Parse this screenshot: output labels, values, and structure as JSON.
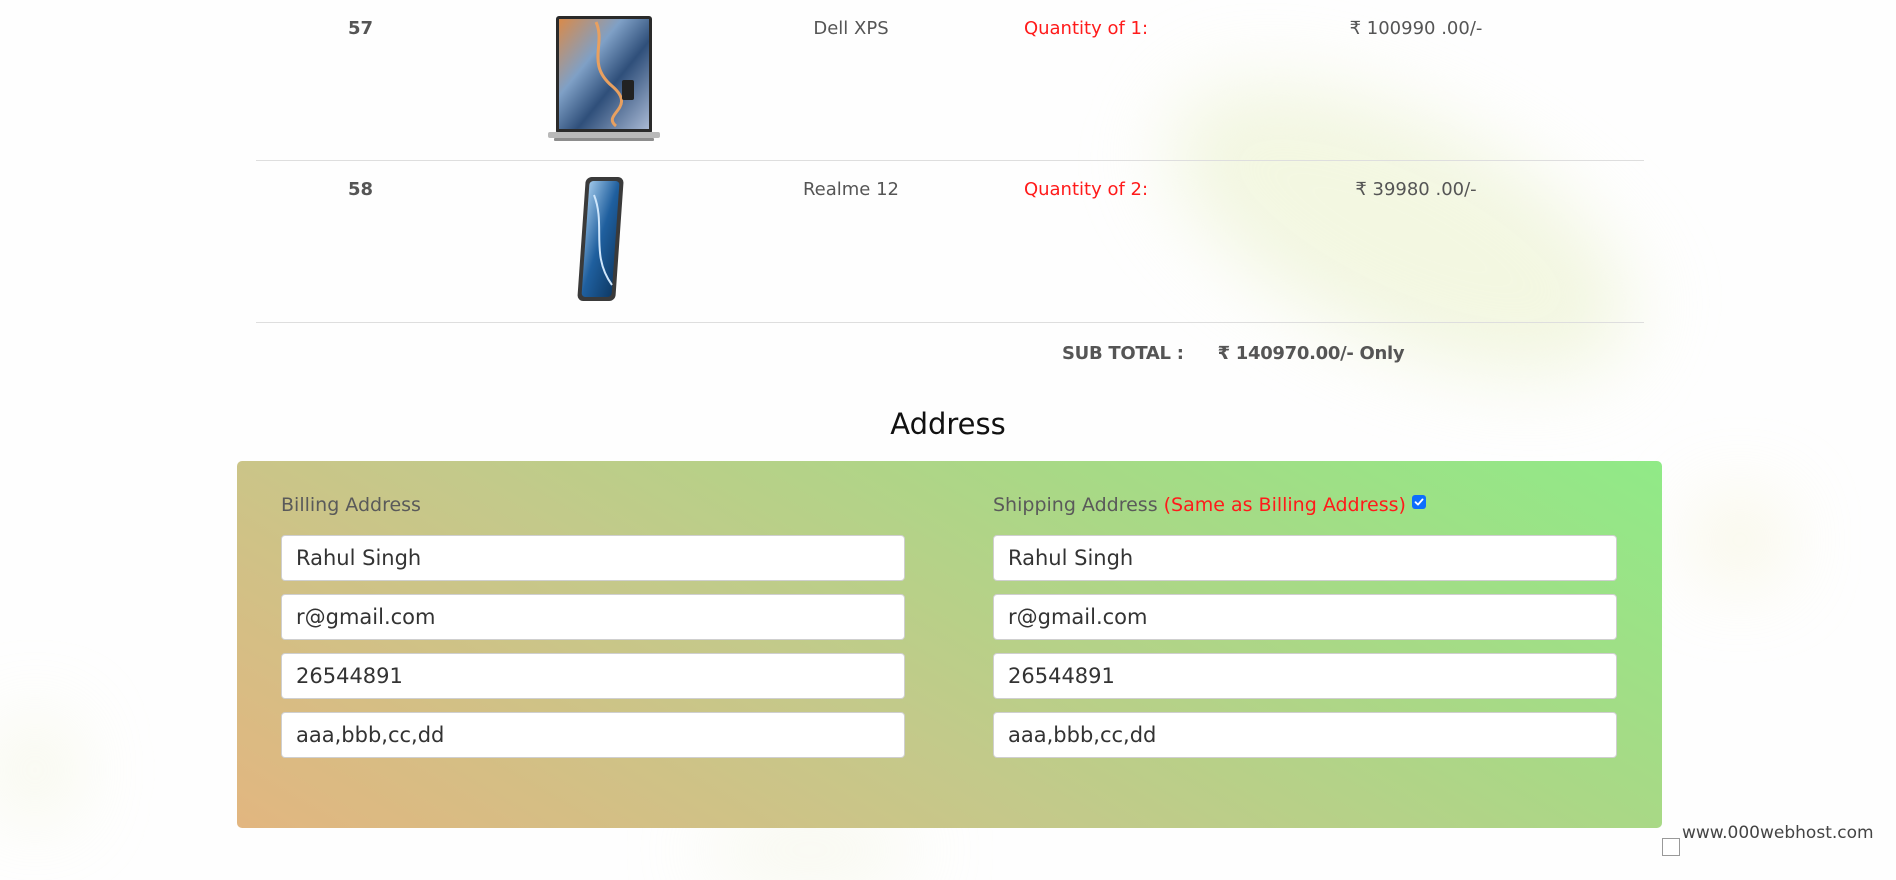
{
  "cart": {
    "rows": [
      {
        "id": "57",
        "product_image": "dell-xps-laptop",
        "name": "Dell XPS",
        "quantity": "Quantity of 1:",
        "price": "₹ 100990 .00/-"
      },
      {
        "id": "58",
        "product_image": "realme-12-phone",
        "name": "Realme 12",
        "quantity": "Quantity of 2:",
        "price": "₹ 39980 .00/-"
      }
    ],
    "subtotal_label": "SUB TOTAL :",
    "subtotal_value": "₹ 140970.00/- Only"
  },
  "address": {
    "heading": "Address",
    "billing": {
      "title": "Billing Address",
      "name": "Rahul Singh",
      "email": "r@gmail.com",
      "phone": "26544891",
      "street": "aaa,bbb,cc,dd"
    },
    "shipping": {
      "title": "Shipping Address",
      "same_note": "(Same as Billing Address)",
      "same_checked": true,
      "name": "Rahul Singh",
      "email": "r@gmail.com",
      "phone": "26544891",
      "street": "aaa,bbb,cc,dd"
    }
  },
  "footer": {
    "badge_text": "www.000webhost.com"
  },
  "colors": {
    "quantity": "#ff1a1a",
    "checkbox": "#0d6efd",
    "panel_gradient_start": "#e2b680",
    "panel_gradient_end": "#90ea87"
  }
}
